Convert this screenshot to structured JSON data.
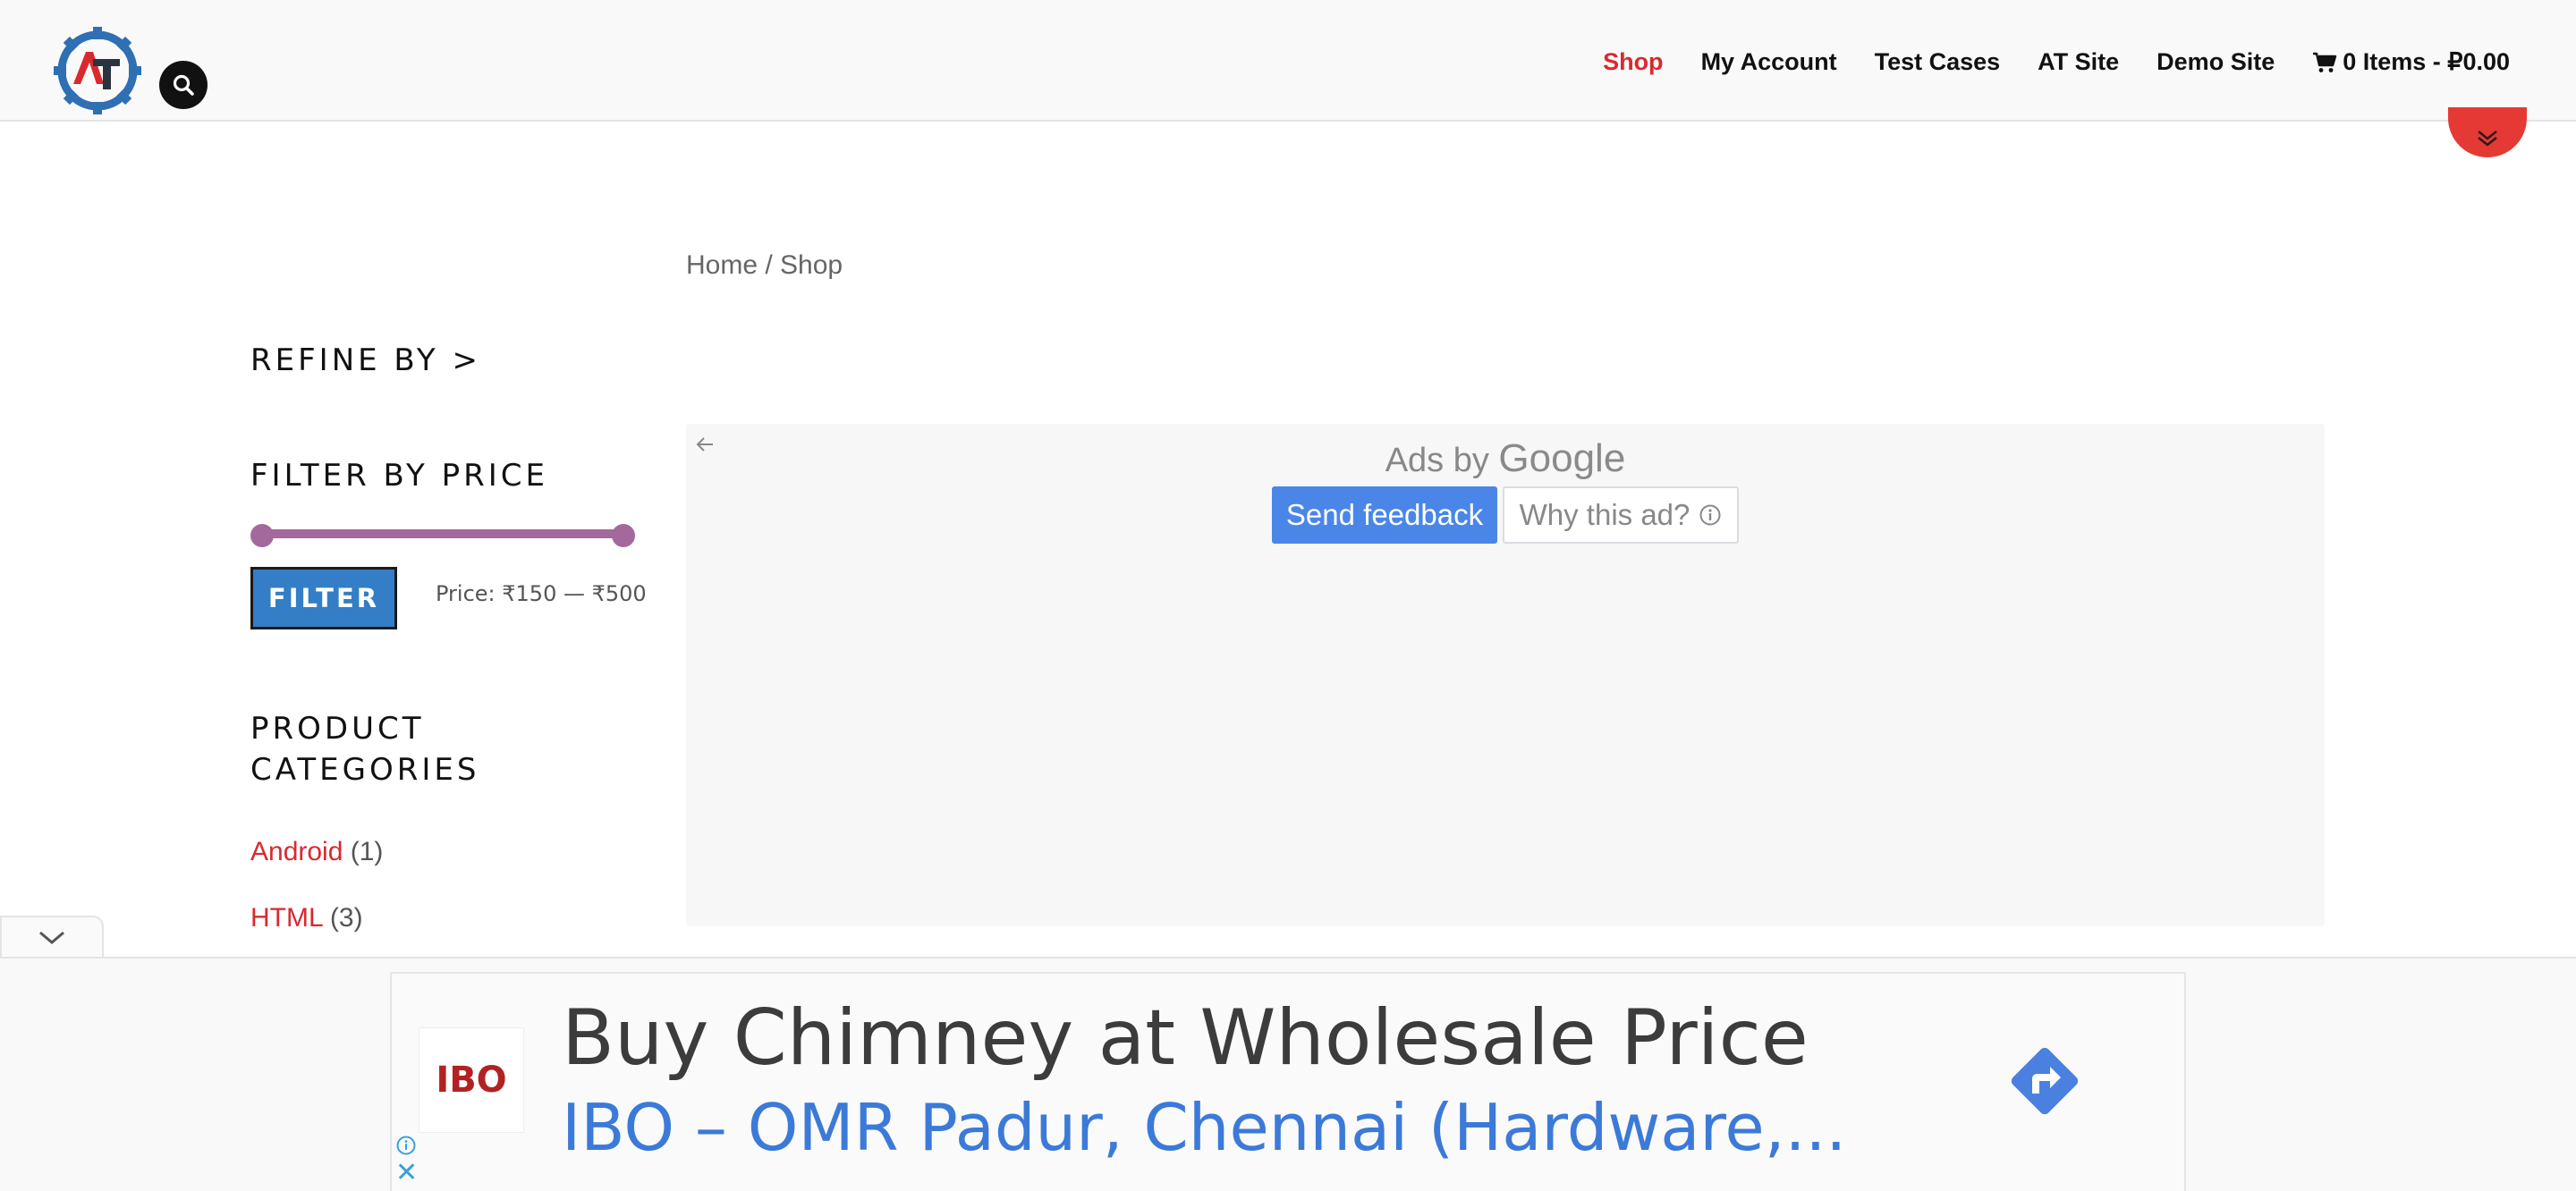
{
  "header": {
    "nav": [
      {
        "label": "Shop",
        "active": true
      },
      {
        "label": "My Account",
        "active": false
      },
      {
        "label": "Test Cases",
        "active": false
      },
      {
        "label": "AT Site",
        "active": false
      },
      {
        "label": "Demo Site",
        "active": false
      }
    ],
    "cart_label": "0 Items - ₽0.00",
    "icons": {
      "logo": "automation-testing-gear-logo",
      "search": "search-icon",
      "cart": "cart-icon",
      "scroll": "chevron-double-down-icon"
    },
    "accent_color": "#d9292e"
  },
  "breadcrumb": "Home / Shop",
  "sidebar": {
    "refine_title": "REFINE BY >",
    "filter_title": "FILTER BY PRICE",
    "filter_button": "FILTER",
    "price_label": "Price: ₹150 — ₹500",
    "price_min_fraction": 0.0,
    "price_max_fraction": 1.0,
    "categories_title": "PRODUCT CATEGORIES",
    "categories": [
      {
        "name": "Android",
        "count": "(1)"
      },
      {
        "name": "HTML",
        "count": "(3)"
      }
    ]
  },
  "ad": {
    "ads_by": "Ads by",
    "google": "Google",
    "send_feedback": "Send feedback",
    "why_this_ad": "Why this ad?"
  },
  "anchor_ad": {
    "logo_text": "IBO",
    "headline": "Buy Chimney at Wholesale Price",
    "subline": "IBO – OMR Padur, Chennai (Hardware,..."
  }
}
